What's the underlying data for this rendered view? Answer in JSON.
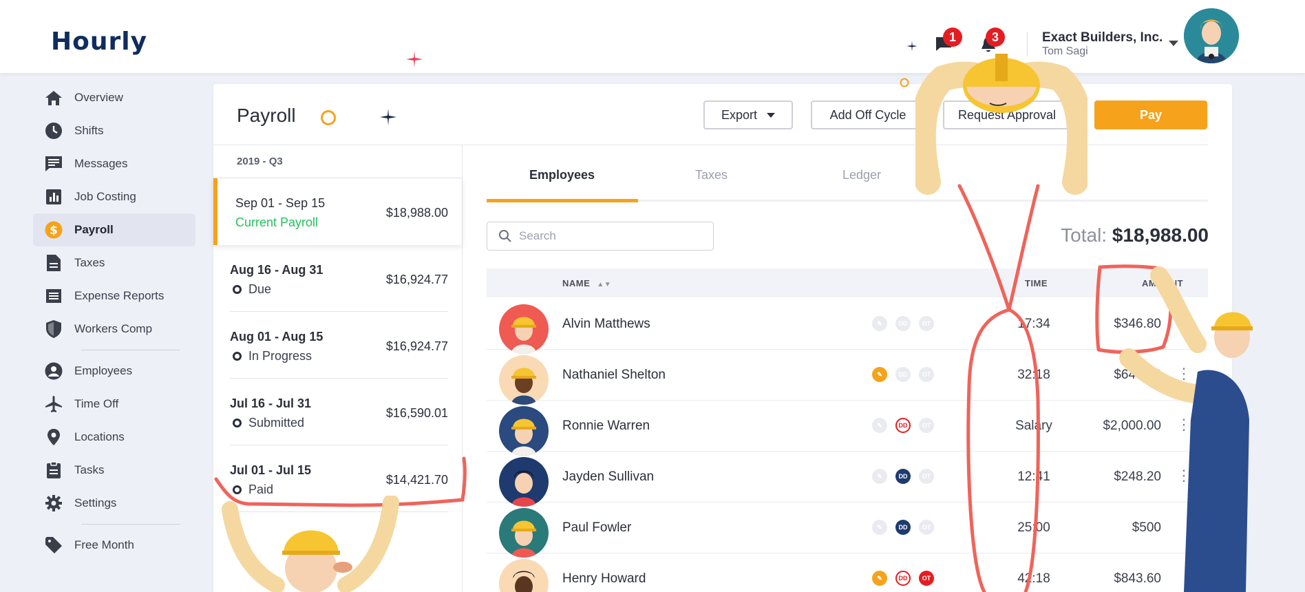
{
  "app": {
    "logo": "Hourly"
  },
  "header": {
    "messages_count": "1",
    "notifications_count": "3",
    "company": "Exact Builders, Inc.",
    "user": "Tom Sagi"
  },
  "sidebar": {
    "items": [
      {
        "label": "Overview",
        "icon": "home-icon"
      },
      {
        "label": "Shifts",
        "icon": "clock-icon"
      },
      {
        "label": "Messages",
        "icon": "message-icon"
      },
      {
        "label": "Job Costing",
        "icon": "bar-chart-icon"
      },
      {
        "label": "Payroll",
        "icon": "dollar-icon",
        "active": true
      },
      {
        "label": "Taxes",
        "icon": "document-icon"
      },
      {
        "label": "Expense Reports",
        "icon": "receipt-icon"
      },
      {
        "label": "Workers Comp",
        "icon": "shield-icon"
      },
      {
        "label": "Employees",
        "icon": "user-icon"
      },
      {
        "label": "Time Off",
        "icon": "airplane-icon"
      },
      {
        "label": "Locations",
        "icon": "pin-icon"
      },
      {
        "label": "Tasks",
        "icon": "clipboard-icon"
      },
      {
        "label": "Settings",
        "icon": "gear-icon"
      },
      {
        "label": "Free Month",
        "icon": "tag-icon"
      }
    ]
  },
  "page": {
    "title": "Payroll",
    "buttons": {
      "export": "Export",
      "add_off_cycle": "Add Off Cycle",
      "request_approval": "Request Approval",
      "pay": "Pay"
    }
  },
  "periods": {
    "quarter": "2019 - Q3",
    "items": [
      {
        "range": "Sep 01 - Sep 15",
        "status": "Current Payroll",
        "amount": "$18,988.00"
      },
      {
        "range": "Aug 16 - Aug 31",
        "status": "Due",
        "amount": "$16,924.77"
      },
      {
        "range": "Aug 01 - Aug 15",
        "status": "In Progress",
        "amount": "$16,924.77"
      },
      {
        "range": "Jul 16 - Jul 31",
        "status": "Submitted",
        "amount": "$16,590.01"
      },
      {
        "range": "Jul 01 - Jul 15",
        "status": "Paid",
        "amount": "$14,421.70"
      }
    ]
  },
  "tabs": {
    "employees": "Employees",
    "taxes": "Taxes",
    "ledger": "Ledger"
  },
  "search": {
    "placeholder": "Search"
  },
  "total": {
    "label": "Total:",
    "value": "$18,988.00"
  },
  "table": {
    "headers": {
      "name": "NAME",
      "time": "TIME",
      "amount": "AMOUNT"
    },
    "flag_labels": {
      "dd": "DD",
      "ot": "OT"
    },
    "rows": [
      {
        "name": "Alvin Matthews",
        "time": "17:34",
        "amount": "$346.80"
      },
      {
        "name": "Nathaniel Shelton",
        "time": "32:18",
        "amount": "$643.50"
      },
      {
        "name": "Ronnie Warren",
        "time": "Salary",
        "amount": "$2,000.00"
      },
      {
        "name": "Jayden Sullivan",
        "time": "12:41",
        "amount": "$248.20"
      },
      {
        "name": "Paul Fowler",
        "time": "25:00",
        "amount": "$500"
      },
      {
        "name": "Henry Howard",
        "time": "42:18",
        "amount": "$843.60"
      }
    ]
  },
  "colors": {
    "accent": "#f7a21b",
    "brand": "#0f2d5e",
    "success": "#23c05a",
    "badge": "#e51d22",
    "annotation": "#f0635a"
  }
}
